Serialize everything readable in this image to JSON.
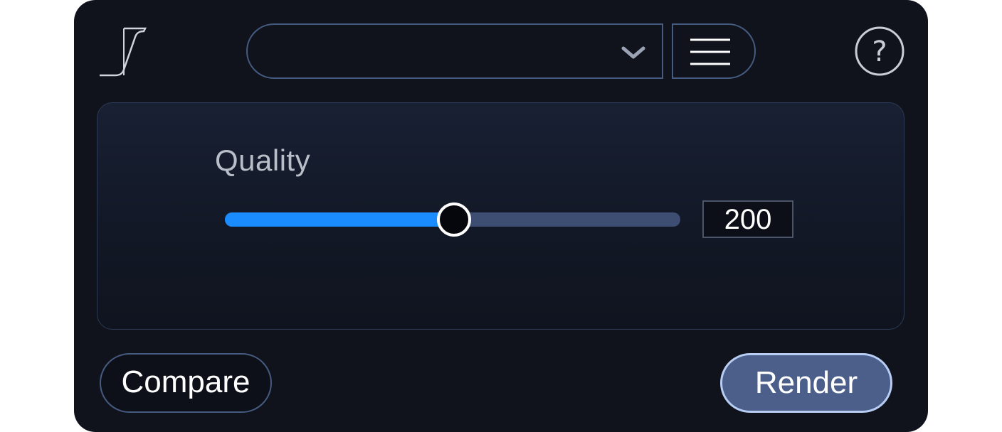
{
  "toolbar": {
    "logo_icon": "s-curve-logo-icon",
    "preset": {
      "selected": "",
      "chevron_icon": "chevron-down-icon"
    },
    "menu_icon": "hamburger-menu-icon",
    "help_label": "?"
  },
  "panel": {
    "quality": {
      "label": "Quality",
      "value": "200",
      "fraction": 0.5
    }
  },
  "actions": {
    "compare_label": "Compare",
    "render_label": "Render"
  },
  "colors": {
    "background": "#10131c",
    "accent": "#1a8cff",
    "border": "#465b80",
    "render_fill": "#4b5f8a",
    "render_border": "#b7cdf3"
  }
}
